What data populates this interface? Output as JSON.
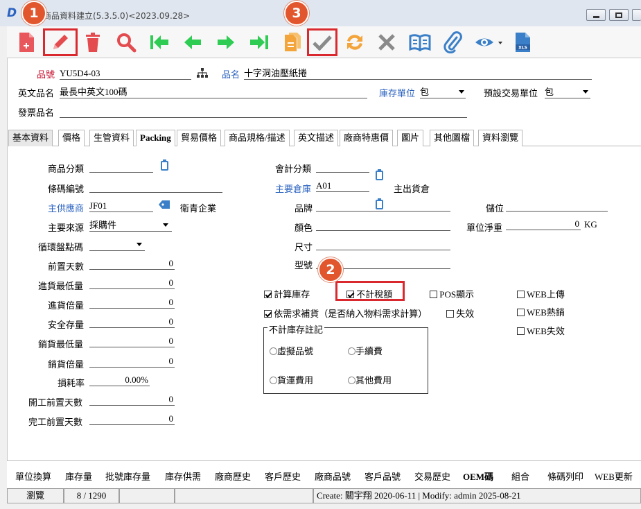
{
  "window": {
    "title": "商品資料建立(5.3.5.0)<2023.09.28>",
    "logo": "D"
  },
  "toolbar": {
    "buttons": [
      "new",
      "edit",
      "delete",
      "search",
      "first",
      "prev",
      "next",
      "last",
      "copy",
      "confirm",
      "refresh",
      "cancel",
      "book",
      "attach",
      "view",
      "excel"
    ],
    "markers": [
      "1",
      "2",
      "3"
    ]
  },
  "header": {
    "item_no_label": "品號",
    "item_no": "YU5D4-03",
    "item_name_label": "品名",
    "item_name": "十字洞油壓紙捲",
    "en_name_label": "英文品名",
    "en_name": "最長中英文100碼",
    "stock_unit_label": "庫存單位",
    "stock_unit": "包",
    "trade_unit_label": "預設交易單位",
    "trade_unit": "包",
    "invoice_name_label": "發票品名",
    "invoice_name": ""
  },
  "tabs": [
    "基本資料",
    "價格",
    "生管資料",
    "Packing",
    "貿易價格",
    "商品規格/描述",
    "英文描述",
    "廠商特惠價",
    "圖片",
    "其他圖檔",
    "資料瀏覽"
  ],
  "left": {
    "category_label": "商品分類",
    "category": "",
    "barcode_label": "條碼編號",
    "barcode": "",
    "supplier_label": "主供應商",
    "supplier_code": "JF01",
    "supplier_name": "衛青企業",
    "source_label": "主要來源",
    "source": "採購件",
    "cycle_label": "循環盤點碼",
    "cycle": "",
    "lead_days_label": "前置天數",
    "lead_days": "0",
    "min_purchase_label": "進貨最低量",
    "min_purchase": "0",
    "purchase_multiple_label": "進貨倍量",
    "purchase_multiple": "0",
    "safety_stock_label": "安全存量",
    "safety_stock": "0",
    "min_sales_label": "銷貨最低量",
    "min_sales": "0",
    "sales_multiple_label": "銷貨倍量",
    "sales_multiple": "0",
    "loss_rate_label": "損耗率",
    "loss_rate": "0.00%",
    "start_lead_label": "開工前置天數",
    "start_lead": "0",
    "finish_lead_label": "完工前置天數",
    "finish_lead": "0"
  },
  "middle": {
    "accounting_label": "會計分類",
    "accounting": "",
    "warehouse_label": "主要倉庫",
    "warehouse_code": "A01",
    "warehouse_name": "主出貨倉",
    "brand_label": "品牌",
    "color_label": "顏色",
    "size_label": "尺寸",
    "model_label": "型號"
  },
  "right": {
    "location_label": "儲位",
    "location": "",
    "net_weight_label": "單位淨重",
    "net_weight": "0",
    "weight_unit": "KG"
  },
  "checks": {
    "calc_stock": "計算庫存",
    "no_tax": "不計稅額",
    "pos_show": "POS顯示",
    "web_upload": "WEB上傳",
    "demand_replenish": "依需求補貨（是否納入物料需求計算）",
    "invalid": "失效",
    "web_hot": "WEB熱銷",
    "web_invalid": "WEB失效"
  },
  "nostock_group": {
    "title": "不計庫存註記",
    "virtual": "虛擬品號",
    "fee": "手續費",
    "freight": "貨運費用",
    "other": "其他費用"
  },
  "bottom_buttons": [
    "單位換算",
    "庫存量",
    "批號庫存量",
    "庫存供需",
    "廠商歷史",
    "客戶歷史",
    "廠商品號",
    "客戶品號",
    "交易歷史",
    "OEM碼",
    "組合",
    "條碼列印",
    "WEB更新"
  ],
  "status": {
    "mode": "瀏覽",
    "record": "8 / 1290",
    "audit": "Create: 關宇翔 2020-06-11 | Modify: admin 2025-08-21"
  }
}
